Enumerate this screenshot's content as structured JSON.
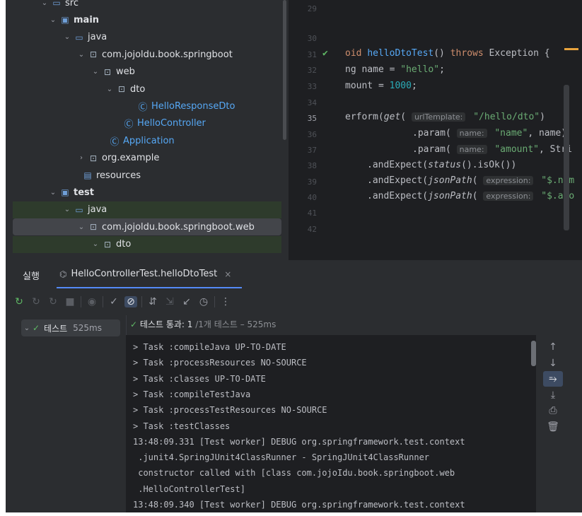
{
  "tree": {
    "items": [
      {
        "label": "src",
        "arrow": "⌄",
        "icon": "folder-icon",
        "glyph": "▭",
        "style": "normal"
      },
      {
        "label": "main",
        "arrow": "⌄",
        "icon": "source-folder-icon",
        "glyph": "▣",
        "style": "bold"
      },
      {
        "label": "java",
        "arrow": "⌄",
        "icon": "java-folder-icon",
        "glyph": "▭",
        "style": "normal"
      },
      {
        "label": "com.jojoldu.book.springboot",
        "arrow": "⌄",
        "icon": "package-icon",
        "glyph": "⊡",
        "style": "normal"
      },
      {
        "label": "web",
        "arrow": "⌄",
        "icon": "package-icon",
        "glyph": "⊡",
        "style": "normal"
      },
      {
        "label": "dto",
        "arrow": "⌄",
        "icon": "package-icon",
        "glyph": "⊡",
        "style": "normal"
      },
      {
        "label": "HelloResponseDto",
        "arrow": "",
        "icon": "class-icon",
        "glyph": "Ⓒ",
        "style": "blue"
      },
      {
        "label": "HelloController",
        "arrow": "",
        "icon": "class-icon",
        "glyph": "Ⓒ",
        "style": "blue"
      },
      {
        "label": "Application",
        "arrow": "",
        "icon": "class-icon",
        "glyph": "Ⓒ",
        "style": "blue"
      },
      {
        "label": "org.example",
        "arrow": "›",
        "icon": "package-icon",
        "glyph": "⊡",
        "style": "normal"
      },
      {
        "label": "resources",
        "arrow": "",
        "icon": "resources-folder-icon",
        "glyph": "▤",
        "style": "normal"
      },
      {
        "label": "test",
        "arrow": "⌄",
        "icon": "test-folder-icon",
        "glyph": "▣",
        "style": "bold"
      },
      {
        "label": "java",
        "arrow": "⌄",
        "icon": "java-folder-icon",
        "glyph": "▭",
        "style": "normal"
      },
      {
        "label": "com.jojoldu.book.springboot.web",
        "arrow": "⌄",
        "icon": "package-icon",
        "glyph": "⊡",
        "style": "normal"
      },
      {
        "label": "dto",
        "arrow": "⌄",
        "icon": "package-icon",
        "glyph": "⊡",
        "style": "normal"
      }
    ]
  },
  "editor": {
    "line_numbers": [
      "29",
      "30",
      "31",
      "32",
      "33",
      "34",
      "35",
      "36",
      "37",
      "38",
      "39",
      "40",
      "41",
      "42"
    ],
    "current_line": "35",
    "lines": {
      "l31": {
        "void": "oid",
        "name": "helloDtoTest",
        "rest": "() ",
        "throws": "throws",
        "exc": " Exception {"
      },
      "l32": {
        "type": "ng name = ",
        "value": "\"hello\"",
        "end": ";"
      },
      "l33": {
        "type": "mount = ",
        "value": "1000",
        "end": ";"
      },
      "l35": {
        "pre": "erform(",
        "get": "get",
        "open": "( ",
        "hint": "urlTemplate:",
        "value": " \"/hello/dto\"",
        "close": ")"
      },
      "l36": {
        "pre": ".param( ",
        "hint": "name:",
        "value": " \"name\"",
        "rest": ", name)"
      },
      "l37": {
        "pre": ".param( ",
        "hint": "name:",
        "value": " \"amount\"",
        "rest": ", Stri"
      },
      "l38": {
        "pre": ".andExpect(",
        "fn": "status",
        "rest": "().isOk())"
      },
      "l39": {
        "pre": ".andExpect(",
        "fn": "jsonPath",
        "open": "( ",
        "hint": "expression:",
        "value": " \"$.nam"
      },
      "l40": {
        "pre": ".andExpect(",
        "fn": "jsonPath",
        "open": "( ",
        "hint": "expression:",
        "value": " \"$.amo"
      }
    }
  },
  "run": {
    "tab_run": "실행",
    "tab_test": "HelloControllerTest.helloDtoTest",
    "tab_close": "×",
    "toolbar_icons": [
      {
        "name": "rerun-icon",
        "glyph": "↻",
        "style": "green"
      },
      {
        "name": "rerun-failed-icon",
        "glyph": "↻",
        "style": "dim"
      },
      {
        "name": "toggle-auto-test-icon",
        "glyph": "↻",
        "style": "dim"
      },
      {
        "name": "stop-icon",
        "glyph": "■",
        "style": "dim"
      },
      {
        "name": "sep",
        "glyph": "",
        "style": "sep"
      },
      {
        "name": "show-passed-icon",
        "glyph": "◉",
        "style": "dim"
      },
      {
        "name": "sep",
        "glyph": "",
        "style": "sep"
      },
      {
        "name": "checkmark-icon",
        "glyph": "✓",
        "style": "normal"
      },
      {
        "name": "show-ignored-icon",
        "glyph": "⊘",
        "style": "on"
      },
      {
        "name": "sep",
        "glyph": "",
        "style": "sep"
      },
      {
        "name": "sort-icon",
        "glyph": "⇵",
        "style": "normal"
      },
      {
        "name": "collapse-icon",
        "glyph": "⇲",
        "style": "dim"
      },
      {
        "name": "import-icon",
        "glyph": "↙",
        "style": "normal"
      },
      {
        "name": "history-icon",
        "glyph": "◷",
        "style": "normal"
      },
      {
        "name": "sep",
        "glyph": "",
        "style": "sep"
      },
      {
        "name": "more-icon",
        "glyph": "⋮",
        "style": "normal"
      }
    ],
    "test_node": {
      "label": "테스트",
      "time": "525ms"
    },
    "summary": {
      "check": "✓",
      "passed": "테스트 통과: 1",
      "total": " /1개 테스트 – 525ms"
    },
    "console_lines": [
      "> Task :compileJava UP-TO-DATE",
      "> Task :processResources NO-SOURCE",
      "> Task :classes UP-TO-DATE",
      "> Task :compileTestJava",
      "> Task :processTestResources NO-SOURCE",
      "> Task :testClasses",
      "13:48:09.331 [Test worker] DEBUG org.springframework.test.context",
      " .junit4.SpringJUnit4ClassRunner - SpringJUnit4ClassRunner",
      " constructor called with [class com.jojoIdu.book.springboot.web",
      " .HelloControllerTest]",
      "13:48:09.340 [Test worker] DEBUG org.springframework.test.context"
    ],
    "side_icons": [
      {
        "name": "scroll-up-icon",
        "glyph": "↑",
        "on": false
      },
      {
        "name": "scroll-down-icon",
        "glyph": "↓",
        "on": false
      },
      {
        "name": "soft-wrap-icon",
        "glyph": "⥱",
        "on": true
      },
      {
        "name": "scroll-to-end-icon",
        "glyph": "⤓",
        "on": false
      },
      {
        "name": "print-icon",
        "glyph": "⎙",
        "on": false
      },
      {
        "name": "trash-icon",
        "glyph": "🗑",
        "on": false
      }
    ]
  }
}
